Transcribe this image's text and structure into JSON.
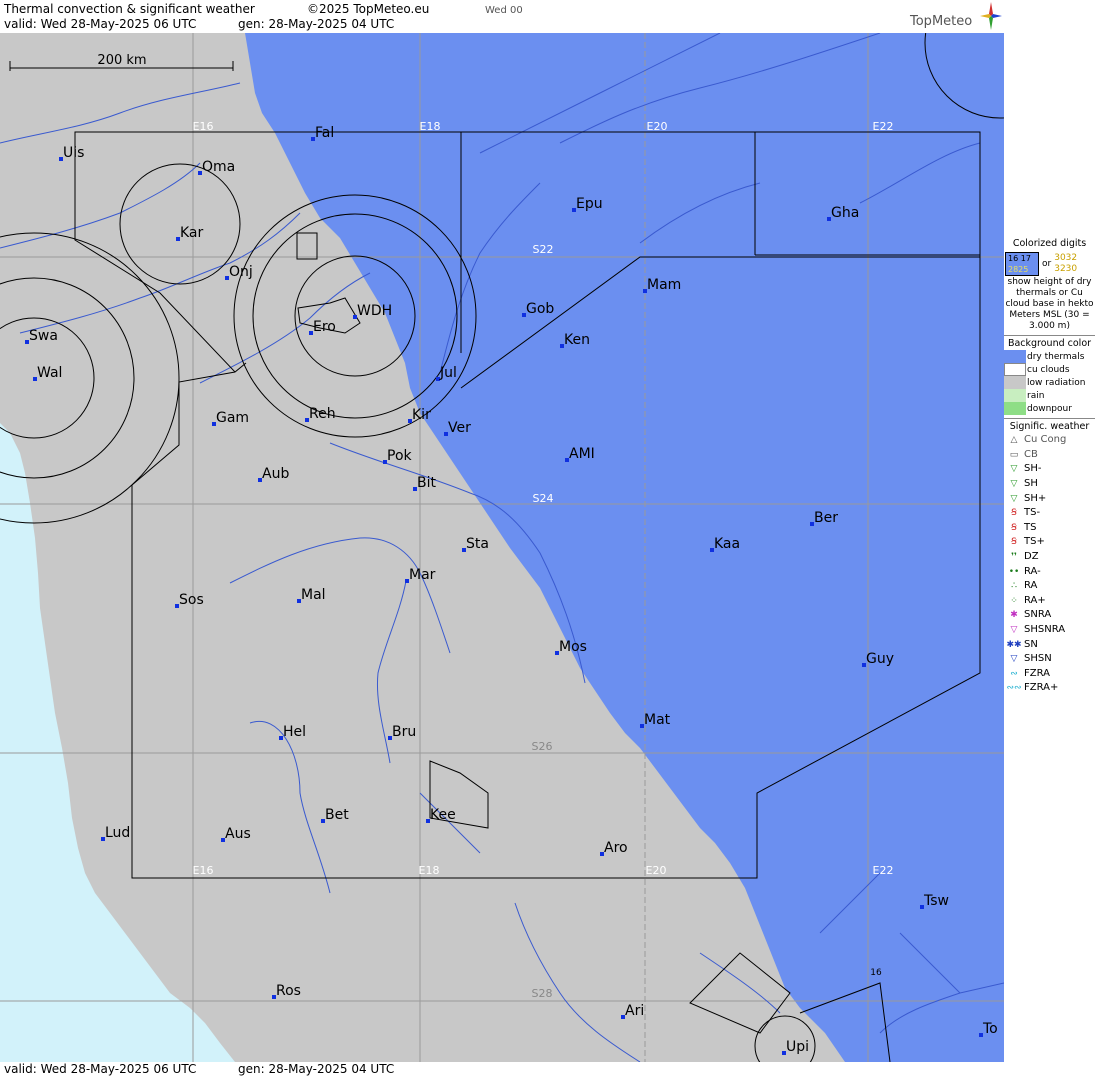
{
  "header": {
    "title": "Thermal convection & significant weather",
    "copyright": "©2025 TopMeteo.eu",
    "forecast_day": "Wed 00",
    "valid": "valid:  Wed  28-May-2025  06 UTC",
    "generated": "gen:  28-May-2025 04 UTC",
    "brand": "TopMeteo"
  },
  "footer": {
    "valid": "valid:  Wed  28-May-2025  06 UTC",
    "generated": "gen:  28-May-2025 04 UTC"
  },
  "map": {
    "scale_label": "200 km",
    "longitude_labels": [
      "E16",
      "E18",
      "E20",
      "E22"
    ],
    "latitude_labels": [
      "S22",
      "S24",
      "S26",
      "S28"
    ],
    "thermal_value": "16",
    "places": [
      {
        "name": "Uis"
      },
      {
        "name": "Oma"
      },
      {
        "name": "Kar"
      },
      {
        "name": "Onj"
      },
      {
        "name": "Fal"
      },
      {
        "name": "Epu"
      },
      {
        "name": "Gha"
      },
      {
        "name": "Mam"
      },
      {
        "name": "Gob"
      },
      {
        "name": "Ken"
      },
      {
        "name": "WDH"
      },
      {
        "name": "Ero"
      },
      {
        "name": "Swa"
      },
      {
        "name": "Wal"
      },
      {
        "name": "Jul"
      },
      {
        "name": "Gam"
      },
      {
        "name": "Reh"
      },
      {
        "name": "Kir"
      },
      {
        "name": "Ver"
      },
      {
        "name": "Pok"
      },
      {
        "name": "AMI"
      },
      {
        "name": "Aub"
      },
      {
        "name": "Bit"
      },
      {
        "name": "Ber"
      },
      {
        "name": "Kaa"
      },
      {
        "name": "Sta"
      },
      {
        "name": "Mar"
      },
      {
        "name": "Sos"
      },
      {
        "name": "Mal"
      },
      {
        "name": "Mos"
      },
      {
        "name": "Guy"
      },
      {
        "name": "Mat"
      },
      {
        "name": "Hel"
      },
      {
        "name": "Bru"
      },
      {
        "name": "Bet"
      },
      {
        "name": "Kee"
      },
      {
        "name": "Lud"
      },
      {
        "name": "Aus"
      },
      {
        "name": "Aro"
      },
      {
        "name": "Tsw"
      },
      {
        "name": "Ros"
      },
      {
        "name": "Ari"
      },
      {
        "name": "To"
      },
      {
        "name": "Upi"
      }
    ]
  },
  "legend": {
    "colorized_title": "Colorized digits",
    "sample_top": "16  17",
    "sample_bottom": "2825",
    "or_label": "or",
    "sample_val_top": "3032",
    "sample_val_bottom": "3230",
    "description": "show height of dry thermals or Cu cloud base in hekto Meters MSL (30 = 3.000 m)",
    "background_title": "Background color",
    "background_items": [
      {
        "label": "dry thermals",
        "color": "#6b8ff0"
      },
      {
        "label": "cu clouds",
        "color": "#ffffff"
      },
      {
        "label": "low radiation",
        "color": "#c8c8c8"
      },
      {
        "label": "rain",
        "color": "#c8eec0"
      },
      {
        "label": "downpour",
        "color": "#8ede86"
      }
    ],
    "weather_title": "Signific. weather",
    "weather_items": [
      {
        "label": "Cu Cong",
        "symbol": "△",
        "color": "#555555"
      },
      {
        "label": "CB",
        "symbol": "▭",
        "color": "#555555"
      },
      {
        "label": "SH-",
        "symbol": "▽",
        "color": "#2a9a2a"
      },
      {
        "label": "SH",
        "symbol": "▽",
        "color": "#2a9a2a"
      },
      {
        "label": "SH+",
        "symbol": "▽",
        "color": "#2a9a2a"
      },
      {
        "label": "TS-",
        "symbol": "Ꞩ",
        "color": "#d02020"
      },
      {
        "label": "TS",
        "symbol": "Ꞩ",
        "color": "#d02020"
      },
      {
        "label": "TS+",
        "symbol": "Ꞩ",
        "color": "#d02020"
      },
      {
        "label": "DZ",
        "symbol": "❜❜",
        "color": "#1a7a1a"
      },
      {
        "label": "RA-",
        "symbol": "••",
        "color": "#1a7a1a"
      },
      {
        "label": "RA",
        "symbol": "∴",
        "color": "#1a7a1a"
      },
      {
        "label": "RA+",
        "symbol": "⁘",
        "color": "#1a7a1a"
      },
      {
        "label": "SNRA",
        "symbol": "✱",
        "color": "#c030c0"
      },
      {
        "label": "SHSNRA",
        "symbol": "▽",
        "color": "#c030c0"
      },
      {
        "label": "SN",
        "symbol": "✱✱",
        "color": "#2040c0"
      },
      {
        "label": "SHSN",
        "symbol": "▽",
        "color": "#2040c0"
      },
      {
        "label": "FZRA",
        "symbol": "∾",
        "color": "#20b0d0"
      },
      {
        "label": "FZRA+",
        "symbol": "∾∾",
        "color": "#20b0d0"
      }
    ]
  }
}
